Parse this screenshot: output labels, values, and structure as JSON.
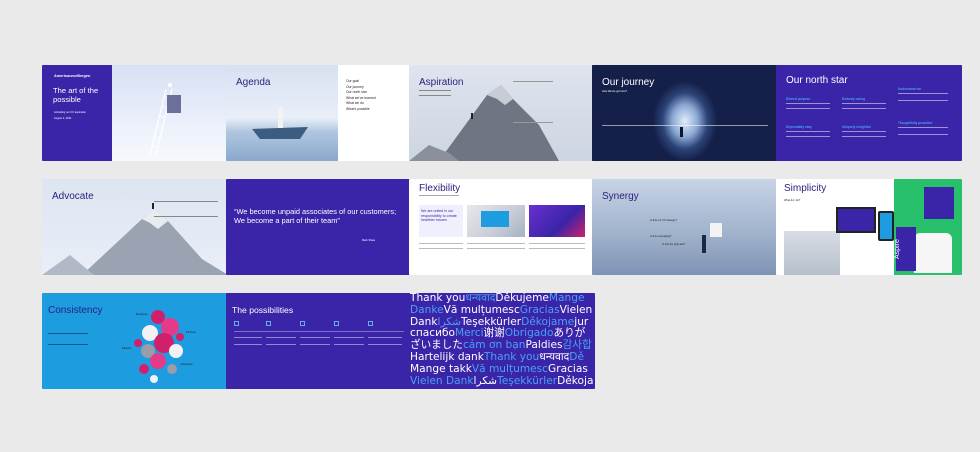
{
  "colors": {
    "purple": "#3a24a8",
    "blue": "#1d9ce0",
    "light_blue": "#4aa0f4",
    "magenta": "#d0206c",
    "green": "#29c06b",
    "background": "#eaeaea"
  },
  "slides": {
    "s1": {
      "brand": "AmerisourceBergen",
      "title": "The art of the possible",
      "sub1": "Activating our CX aspiration",
      "sub2": "August 4, 2021"
    },
    "s2": {
      "title": "Agenda",
      "items": [
        "Our goal",
        "Our journey",
        "Our north star",
        "What we've learned",
        "What we do",
        "What's possible"
      ]
    },
    "s3": {
      "title": "Aspiration"
    },
    "s4": {
      "title": "Our journey",
      "sub": "How did we get here?"
    },
    "s5": {
      "title": "Our north star",
      "headings": [
        "Shared purpose",
        "Embody caring",
        "Understand me",
        "Dependably easy",
        "Uniquely insightful",
        "Thoughtfully proactive"
      ]
    },
    "s6": {
      "title": "Advocate"
    },
    "s7": {
      "quote": "“We become unpaid associates of our customers; We become a part of their team”",
      "attribution": "Mark Shaw"
    },
    "s8": {
      "title": "Flexibility",
      "caption": "We are united in our responsibility to create healthier futures"
    },
    "s9": {
      "title": "Synergy",
      "questions": [
        "Is this our CX strategy?",
        "Is this messaging?",
        "Is this the right ask?"
      ]
    },
    "s10": {
      "title": "Simplicity",
      "sub": "What do I do?",
      "brand": "Aspire"
    },
    "s11": {
      "title": "Consistency",
      "labels": [
        "Employee",
        "Patients",
        "Partners",
        "Caregivers"
      ]
    },
    "s12": {
      "title": "The possibilities"
    },
    "s13": {
      "lines": [
        [
          {
            "w": "Thank you",
            "c": "w"
          },
          {
            "w": "धन्यवाद",
            "c": "b"
          },
          {
            "w": "Děkujeme",
            "c": "w"
          },
          {
            "w": "Mange",
            "c": "b"
          }
        ],
        [
          {
            "w": "Danke",
            "c": "b"
          },
          {
            "w": "Vă mulțumesc",
            "c": "w"
          },
          {
            "w": "Gracias",
            "c": "b"
          },
          {
            "w": "Vielen",
            "c": "w"
          }
        ],
        [
          {
            "w": "Dank",
            "c": "w"
          },
          {
            "w": "شكرا",
            "c": "b"
          },
          {
            "w": "Teşekkürler",
            "c": "w"
          },
          {
            "w": "Děkojame",
            "c": "b"
          },
          {
            "w": "jur",
            "c": "w"
          }
        ],
        [
          {
            "w": "спасибо",
            "c": "w"
          },
          {
            "w": "Merci",
            "c": "b"
          },
          {
            "w": "谢谢",
            "c": "w"
          },
          {
            "w": "Obrigado",
            "c": "b"
          },
          {
            "w": "ありが",
            "c": "w"
          }
        ],
        [
          {
            "w": "ざいました",
            "c": "w"
          },
          {
            "w": "cảm ơn bạn",
            "c": "b"
          },
          {
            "w": "Paldies",
            "c": "w"
          },
          {
            "w": "감사합",
            "c": "b"
          }
        ],
        [
          {
            "w": "Hartelijk dank",
            "c": "w"
          },
          {
            "w": "Thank you",
            "c": "b"
          },
          {
            "w": "धन्यवाद",
            "c": "w"
          },
          {
            "w": "Dě",
            "c": "b"
          }
        ],
        [
          {
            "w": "Mange takk",
            "c": "w"
          },
          {
            "w": "Vă mulțumesc",
            "c": "b"
          },
          {
            "w": "Gracias",
            "c": "w"
          }
        ],
        [
          {
            "w": "Vielen Dank",
            "c": "b"
          },
          {
            "w": "شكرا",
            "c": "w"
          },
          {
            "w": "Teşekkürler",
            "c": "b"
          },
          {
            "w": "Děkoja",
            "c": "w"
          }
        ]
      ]
    }
  }
}
